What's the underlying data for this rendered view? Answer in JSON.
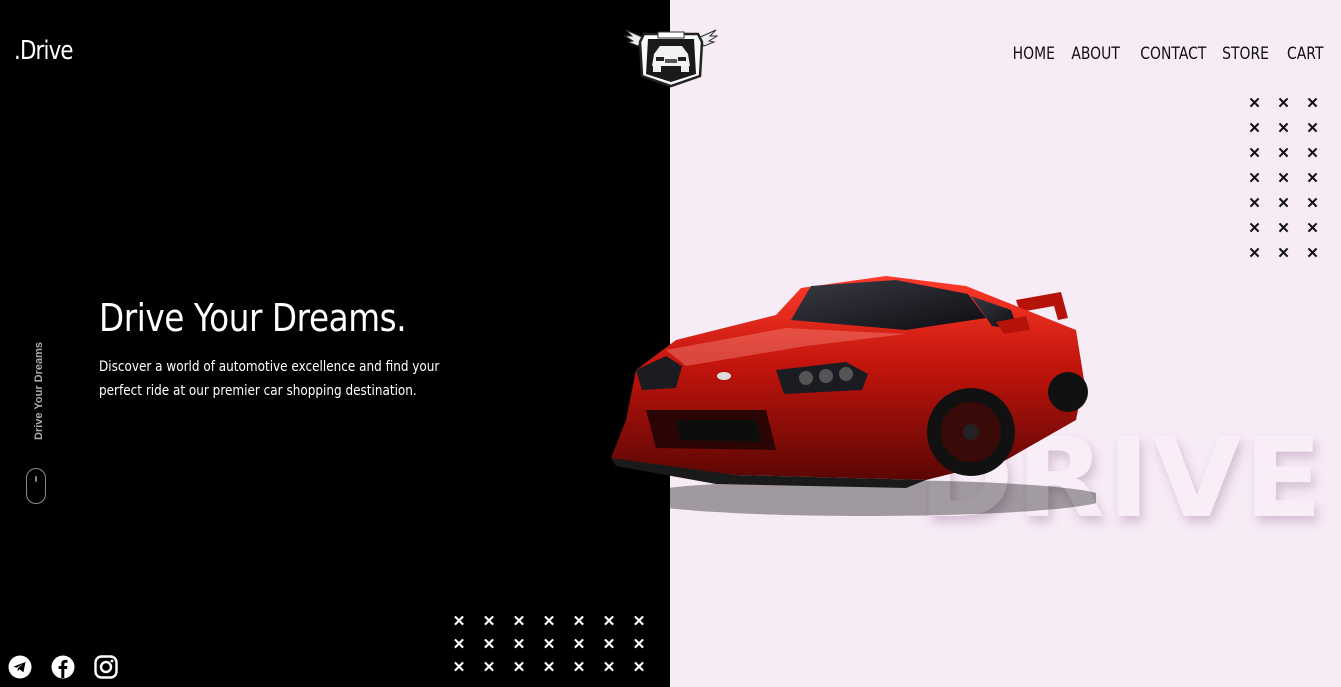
{
  "brand": {
    "name": ".Drive"
  },
  "nav": {
    "items": [
      {
        "label": "HOME"
      },
      {
        "label": "ABOUT"
      },
      {
        "label": "CONTACT"
      },
      {
        "label": "STORE"
      },
      {
        "label": "CART"
      }
    ]
  },
  "hero": {
    "title": "Drive Your Dreams.",
    "description": "Discover a world of automotive excellence and find your perfect ride at our premier car shopping destination."
  },
  "side": {
    "vertical_label": "Drive Your Dreams"
  },
  "watermark": {
    "text": "DRIVE"
  },
  "decor": {
    "mark": "✕"
  },
  "social": [
    {
      "icon": "telegram-icon"
    },
    {
      "icon": "facebook-icon"
    },
    {
      "icon": "instagram-icon"
    }
  ],
  "colors": {
    "left_background": "#000000",
    "right_background": "#f7ebf6",
    "car_accent": "#c0140c"
  }
}
